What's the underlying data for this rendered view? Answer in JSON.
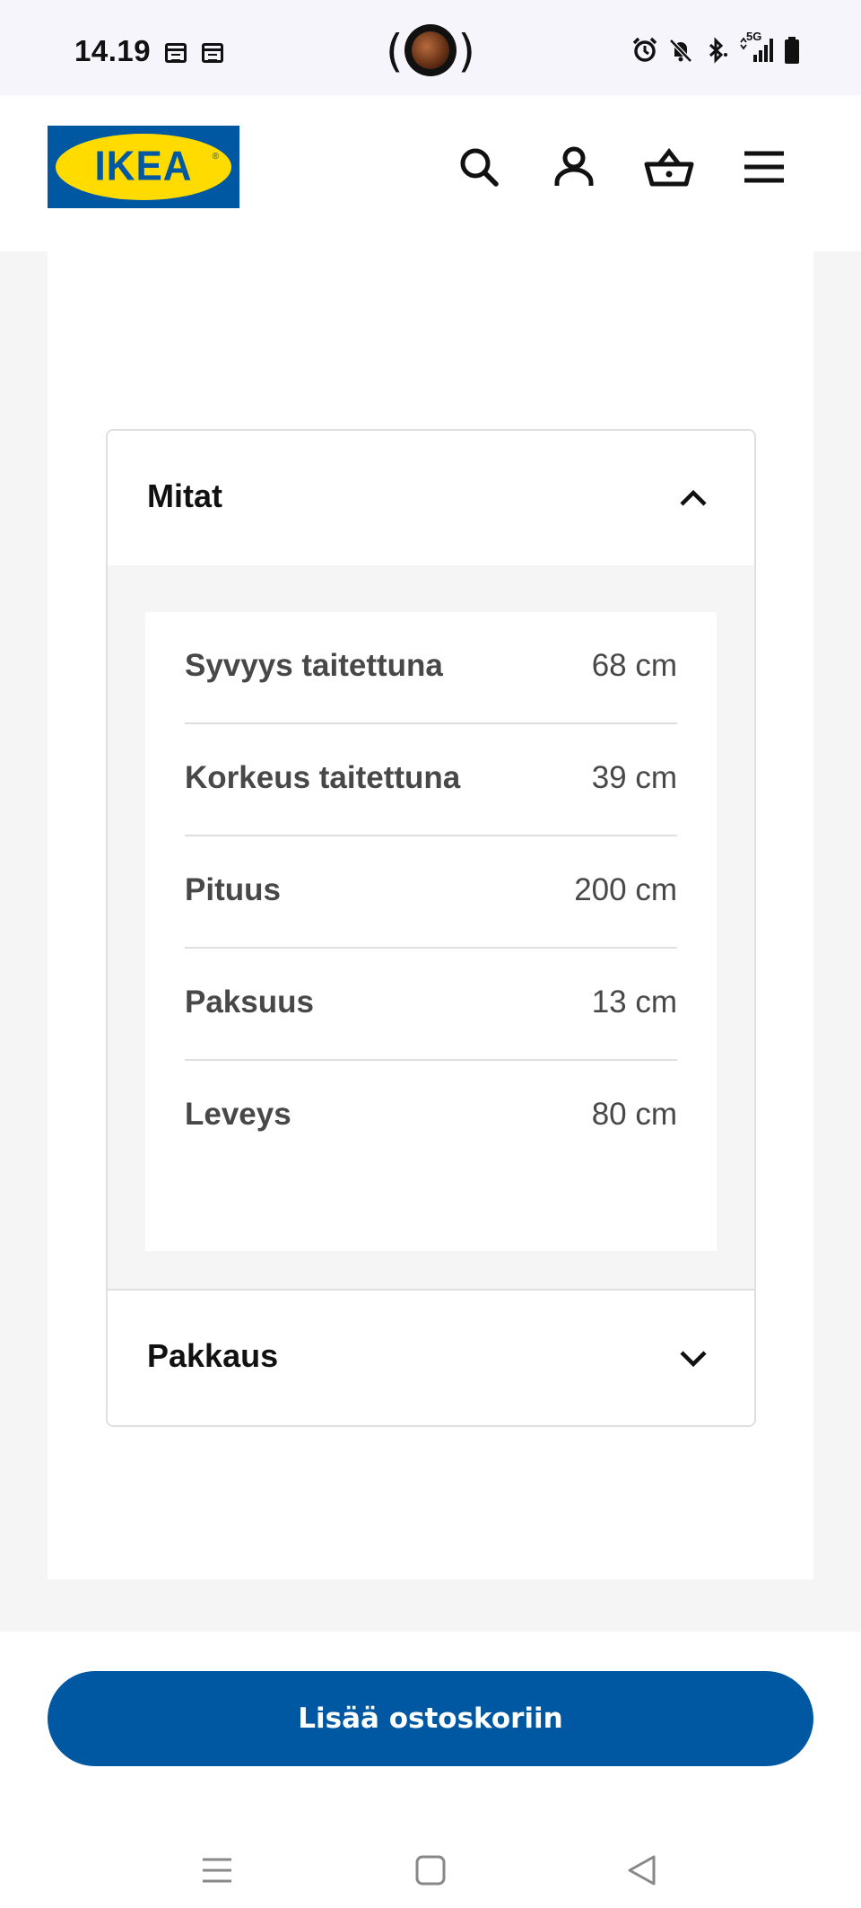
{
  "status_bar": {
    "time": "14.19",
    "network": "5G"
  },
  "header": {
    "logo_text": "IKEA",
    "logo_reg": "®",
    "icons": [
      "search-icon",
      "account-icon",
      "basket-icon",
      "menu-icon"
    ]
  },
  "dimensions": {
    "title": "Mitat",
    "rows": [
      {
        "label": "Syvyys taitettuna",
        "value": "68 cm"
      },
      {
        "label": "Korkeus taitettuna",
        "value": "39 cm"
      },
      {
        "label": "Pituus",
        "value": "200 cm"
      },
      {
        "label": "Paksuus",
        "value": "13 cm"
      },
      {
        "label": "Leveys",
        "value": "80 cm"
      }
    ]
  },
  "packaging": {
    "title": "Pakkaus"
  },
  "cta": {
    "label": "Lisää ostoskoriin"
  },
  "colors": {
    "brand_blue": "#0058a3",
    "brand_yellow": "#ffdb00"
  }
}
